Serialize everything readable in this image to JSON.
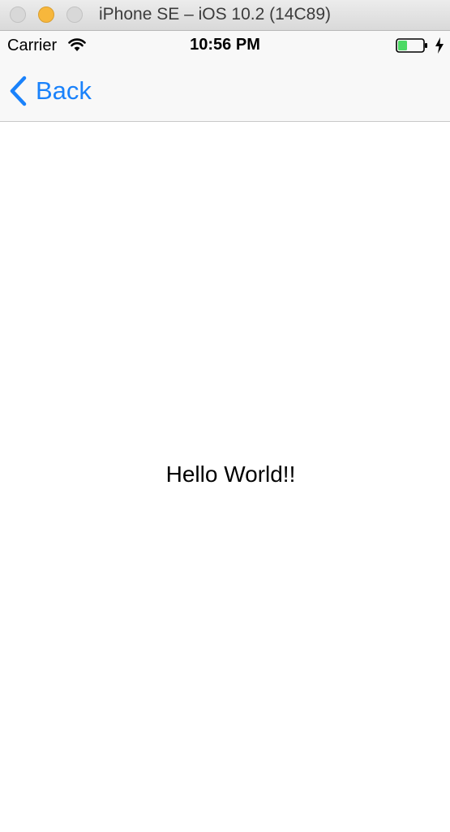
{
  "window": {
    "title": "iPhone SE – iOS 10.2 (14C89)"
  },
  "status_bar": {
    "carrier": "Carrier",
    "time": "10:56 PM",
    "battery_level": 0.35,
    "charging": true
  },
  "nav_bar": {
    "back_label": "Back"
  },
  "content": {
    "message": "Hello World!!"
  },
  "colors": {
    "accent": "#1a82fb",
    "battery_fill": "#4cd964",
    "minimize": "#f7b73c"
  },
  "icons": {
    "wifi": "wifi-icon",
    "battery": "battery-icon",
    "charging": "lightning-bolt-icon",
    "back": "chevron-left-icon"
  }
}
